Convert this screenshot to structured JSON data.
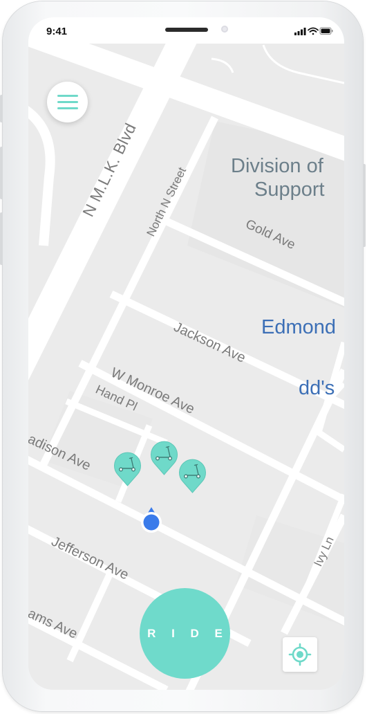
{
  "status_bar": {
    "time": "9:41"
  },
  "map": {
    "labels": {
      "nmlk_blvd": "N M.L.K. Blvd",
      "north_n_street": "North N Street",
      "division_line1": "Division of",
      "division_line2": "Support",
      "gold_ave": "Gold Ave",
      "edmond": "Edmond",
      "jackson_ave": "Jackson Ave",
      "dds": "dd's",
      "w_monroe_ave": "W Monroe Ave",
      "hand_pl": "Hand Pl",
      "madison_ave": "adison Ave",
      "ivy_ln": "Ivy Ln",
      "jefferson_ave": "Jefferson Ave",
      "adams_ave": "ams Ave"
    }
  },
  "controls": {
    "menu_icon": "hamburger-menu-icon",
    "ride_label": "R I D E",
    "locate_icon": "crosshair-target-icon"
  },
  "markers": {
    "scooter_icon": "scooter-icon",
    "count": 3
  },
  "colors": {
    "accent": "#6fdacb",
    "map_background": "#ebebeb",
    "road": "#ffffff",
    "road_label": "#7a7a7a",
    "poi_blue": "#3c6fb6",
    "user_location": "#3a7bea"
  }
}
